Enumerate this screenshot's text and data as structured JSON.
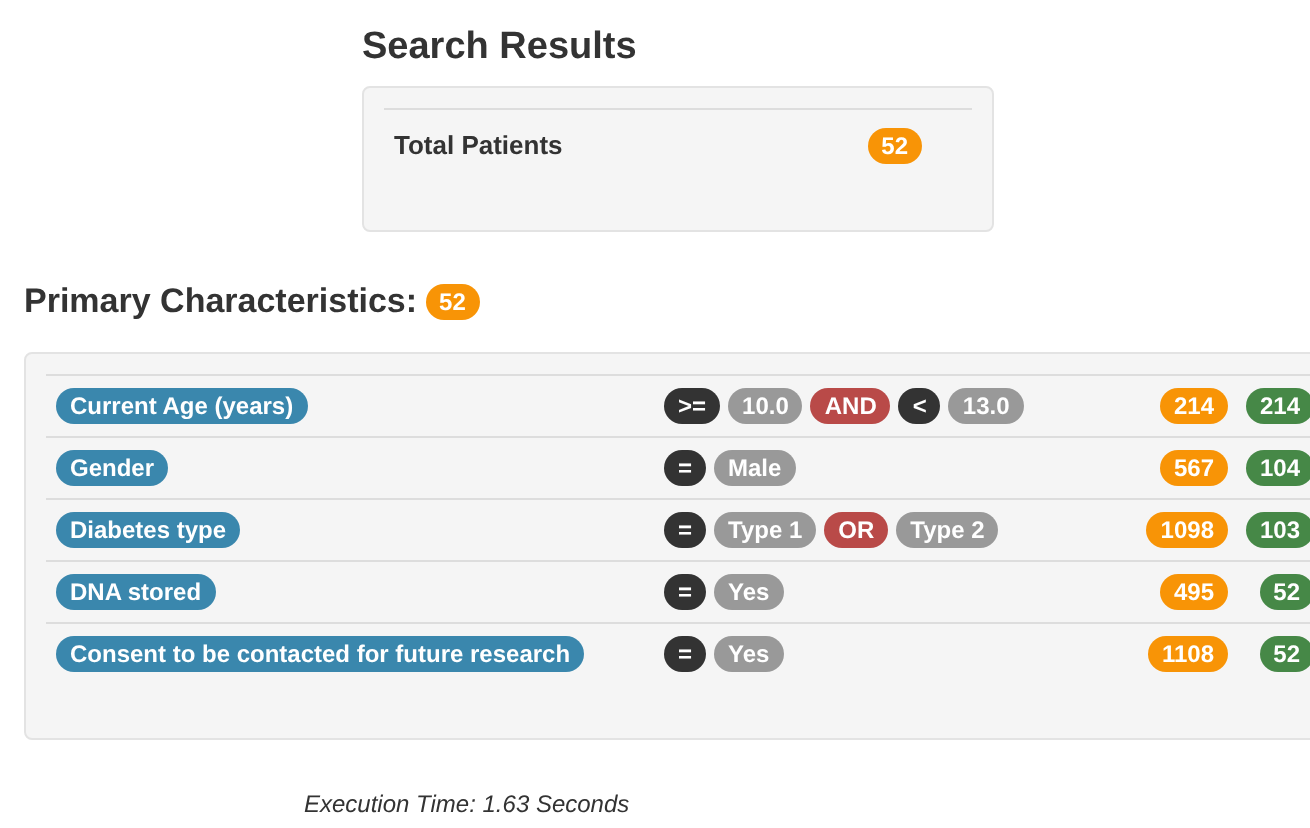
{
  "search_results": {
    "title": "Search Results",
    "total_label": "Total Patients",
    "total_count": "52"
  },
  "primary": {
    "title": "Primary Characteristics:",
    "count": "52",
    "rows": [
      {
        "name": "Current Age (years)",
        "criteria": [
          {
            "kind": "operator",
            "text": ">="
          },
          {
            "kind": "value",
            "text": "10.0"
          },
          {
            "kind": "conjunction",
            "text": "AND"
          },
          {
            "kind": "operator",
            "text": "<"
          },
          {
            "kind": "value",
            "text": "13.0"
          }
        ],
        "count": "214",
        "matched": "214"
      },
      {
        "name": "Gender",
        "criteria": [
          {
            "kind": "operator",
            "text": "="
          },
          {
            "kind": "value",
            "text": "Male"
          }
        ],
        "count": "567",
        "matched": "104"
      },
      {
        "name": "Diabetes type",
        "criteria": [
          {
            "kind": "operator",
            "text": "="
          },
          {
            "kind": "value",
            "text": "Type 1"
          },
          {
            "kind": "conjunction",
            "text": "OR"
          },
          {
            "kind": "value",
            "text": "Type 2"
          }
        ],
        "count": "1098",
        "matched": "103"
      },
      {
        "name": "DNA stored",
        "criteria": [
          {
            "kind": "operator",
            "text": "="
          },
          {
            "kind": "value",
            "text": "Yes"
          }
        ],
        "count": "495",
        "matched": "52"
      },
      {
        "name": "Consent to be contacted for future research",
        "criteria": [
          {
            "kind": "operator",
            "text": "="
          },
          {
            "kind": "value",
            "text": "Yes"
          }
        ],
        "count": "1108",
        "matched": "52"
      }
    ]
  },
  "execution_time": "Execution Time: 1.63 Seconds"
}
